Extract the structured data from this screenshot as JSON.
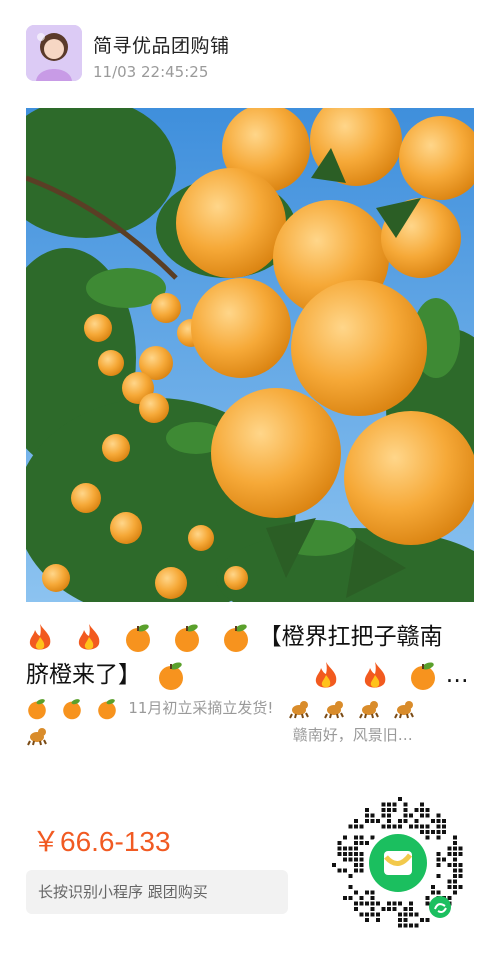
{
  "header": {
    "shop_name": "简寻优品团购铺",
    "timestamp": "11/03 22:45:25",
    "avatar_icon": "user-avatar-photo"
  },
  "photo": {
    "icon": "navel-oranges-on-tree-photo",
    "colors": {
      "sky": "#5ea0e0",
      "leaf": "#2f6b2c",
      "orange": "#f5a623"
    }
  },
  "title": {
    "line1_text": "【橙界扛把子赣南",
    "line2_text": "脐橙来了】",
    "line2_tail": "…"
  },
  "description": {
    "line1_text": "11月初立采摘立发货!",
    "line2_text": "赣南好，风景旧…"
  },
  "price": "￥66.6-133",
  "mini_program_button": "长按识别小程序 跟团购买",
  "qr_code": {
    "icon": "mini-program-qr-code",
    "center_logo": "mini-program-logo-icon",
    "accent": "#07c160"
  }
}
